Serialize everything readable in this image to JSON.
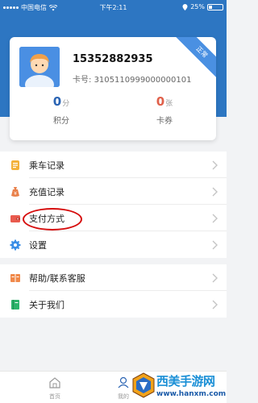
{
  "status_bar": {
    "carrier": "中国电信",
    "time": "下午2:11",
    "battery": "25%"
  },
  "profile": {
    "phone": "15352882935",
    "card_label": "卡号:",
    "card_number": "3105110999000000101",
    "badge": "正常",
    "points_value": "0",
    "points_unit": "分",
    "points_label": "积分",
    "coupons_value": "0",
    "coupons_unit": "张",
    "coupons_label": "卡券"
  },
  "menu_group_1": [
    {
      "label": "乘车记录",
      "icon": "ride-record-icon"
    },
    {
      "label": "充值记录",
      "icon": "recharge-record-icon"
    },
    {
      "label": "支付方式",
      "icon": "wallet-icon"
    },
    {
      "label": "设置",
      "icon": "gear-icon"
    }
  ],
  "menu_group_2": [
    {
      "label": "帮助/联系客服",
      "icon": "help-book-icon"
    },
    {
      "label": "关于我们",
      "icon": "about-book-icon"
    }
  ],
  "tab_bar": {
    "home_label": "首页",
    "mine_label": "我的"
  },
  "watermark": {
    "title": "西美手游网",
    "url": "www.hanxm.com"
  },
  "colors": {
    "header": "#2d76c2",
    "accent": "#2b64b3",
    "coupon": "#e0604a",
    "highlight": "#d60c0c"
  }
}
